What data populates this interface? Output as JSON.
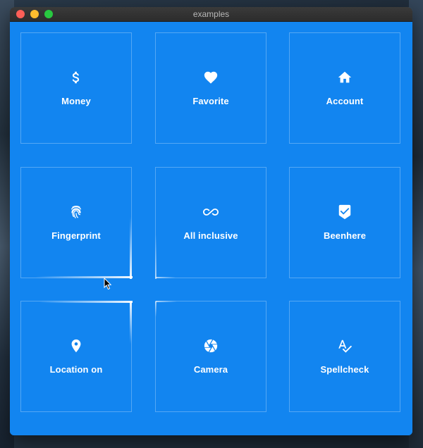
{
  "window": {
    "title": "examples"
  },
  "tiles": [
    {
      "label": "Money",
      "icon": "dollar-icon"
    },
    {
      "label": "Favorite",
      "icon": "heart-icon"
    },
    {
      "label": "Account",
      "icon": "home-icon"
    },
    {
      "label": "Fingerprint",
      "icon": "fingerprint-icon"
    },
    {
      "label": "All inclusive",
      "icon": "infinity-icon"
    },
    {
      "label": "Beenhere",
      "icon": "beenhere-icon"
    },
    {
      "label": "Location on",
      "icon": "location-pin-icon"
    },
    {
      "label": "Camera",
      "icon": "camera-icon"
    },
    {
      "label": "Spellcheck",
      "icon": "spellcheck-icon"
    }
  ],
  "colors": {
    "background": "#1285f0",
    "tile_border": "rgba(255,255,255,0.28)",
    "text": "#ffffff"
  }
}
